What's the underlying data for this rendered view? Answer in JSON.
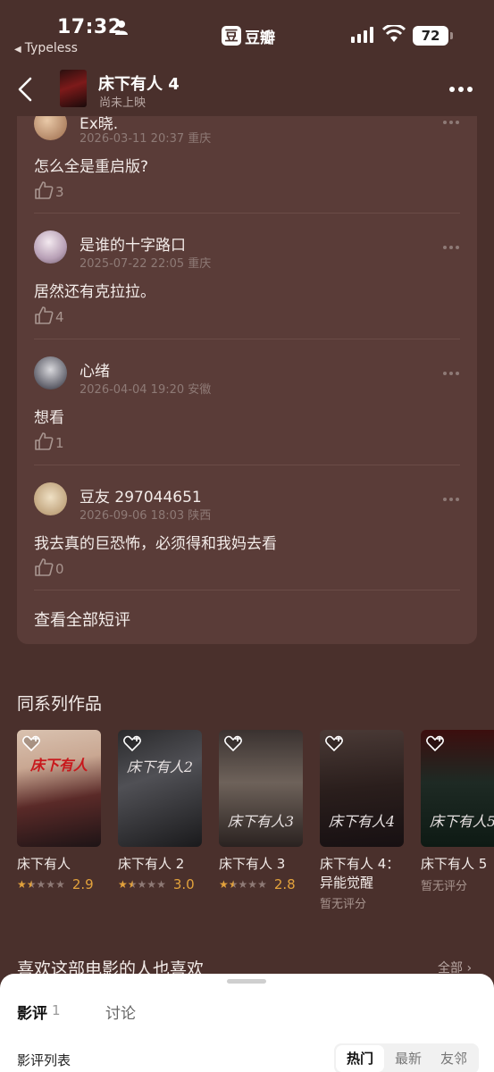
{
  "status_bar": {
    "time": "17:32",
    "back_app": "Typeless",
    "app_logo_char": "豆",
    "app_name": "豆瓣",
    "battery": "72"
  },
  "header": {
    "title": "床下有人 4",
    "subtitle": "尚未上映"
  },
  "comments": [
    {
      "user": "Ex晓.",
      "date": "2026-03-11 20:37 重庆",
      "text": "怎么全是重启版?",
      "likes": "3"
    },
    {
      "user": "是谁的十字路口",
      "date": "2025-07-22 22:05 重庆",
      "text": "居然还有克拉拉。",
      "likes": "4"
    },
    {
      "user": "心绪",
      "date": "2026-04-04 19:20 安徽",
      "text": "想看",
      "likes": "1"
    },
    {
      "user": "豆友 297044651",
      "date": "2026-09-06 18:03 陕西",
      "text": "我去真的巨恐怖，必须得和我妈去看",
      "likes": "0"
    }
  ],
  "view_all_label": "查看全部短评",
  "series": {
    "title": "同系列作品",
    "items": [
      {
        "name": "床下有人",
        "poster_text": "床下有人",
        "score": "2.9",
        "rating_value": 1.5,
        "no_rating": ""
      },
      {
        "name": "床下有人 2",
        "poster_text": "床下有人2",
        "score": "3.0",
        "rating_value": 1.5,
        "no_rating": ""
      },
      {
        "name": "床下有人 3",
        "poster_text": "床下有人3",
        "score": "2.8",
        "rating_value": 1.5,
        "no_rating": ""
      },
      {
        "name": "床下有人 4：异能觉醒",
        "poster_text": "床下有人4",
        "score": "",
        "rating_value": 0,
        "no_rating": "暂无评分"
      },
      {
        "name": "床下有人 5",
        "poster_text": "床下有人5",
        "score": "",
        "rating_value": 0,
        "no_rating": "暂无评分"
      }
    ]
  },
  "also_like": {
    "title": "喜欢这部电影的人也喜欢",
    "all_label": "全部 ›"
  },
  "sheet": {
    "tabs": [
      {
        "label": "影评",
        "count": "1"
      },
      {
        "label": "讨论"
      }
    ],
    "list_label": "影评列表",
    "sort_options": [
      "热门",
      "最新",
      "友邻"
    ]
  },
  "colors": {
    "background": "#4a302c",
    "card": "#5a3c38",
    "rating": "#e3a23c"
  }
}
